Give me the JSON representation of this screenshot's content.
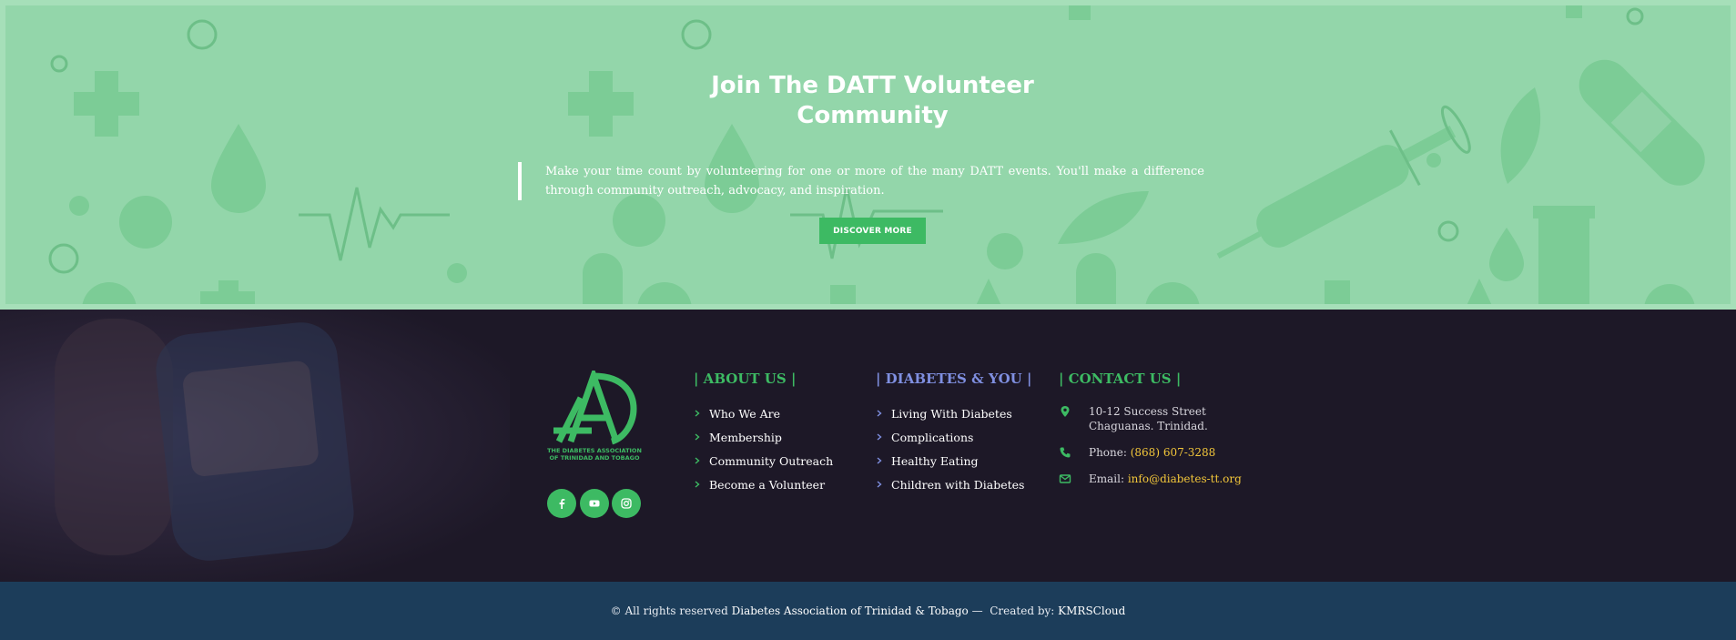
{
  "cta": {
    "title": "Join The DATT Volunteer Community",
    "title_line1": "Join The DATT Volunteer",
    "title_line2": "Community",
    "text": "Make your time count by volunteering for one or more of the many DATT events. You'll make a difference through community outreach, advocacy, and inspiration.",
    "button_label": "DISCOVER MORE"
  },
  "footer": {
    "logo_caption_line1": "THE DIABETES ASSOCIATION",
    "logo_caption_line2": "OF TRINIDAD AND TOBAGO",
    "social": [
      "facebook-icon",
      "youtube-icon",
      "instagram-icon"
    ],
    "about": {
      "title": "| ABOUT US |",
      "links": [
        "Who We Are",
        "Membership",
        "Community Outreach",
        "Become a Volunteer"
      ]
    },
    "diabetes": {
      "title": "| DIABETES & YOU |",
      "links": [
        "Living With Diabetes",
        "Complications",
        "Healthy Eating",
        "Children with Diabetes"
      ]
    },
    "contact": {
      "title": "| CONTACT US |",
      "address_line1": "10-12 Success Street",
      "address_line2": "Chaguanas. Trinidad.",
      "phone_label": "Phone:",
      "phone": "(868) 607-3288",
      "email_label": "Email:",
      "email": "info@diabetes-tt.org"
    }
  },
  "bottom": {
    "copyright_prefix": "© All rights reserved",
    "org": "Diabetes Association of Trinidad & Tobago",
    "separator": "—",
    "created_by": "Created by:",
    "creator": "KMRSCloud"
  },
  "colors": {
    "cta_bg": "#93d6aa",
    "accent_green": "#3dba63",
    "accent_blue": "#7f8fe0",
    "accent_yellow": "#f2c63a",
    "footer_bg": "#1d1827",
    "bottom_bg": "#1c3d5a"
  }
}
